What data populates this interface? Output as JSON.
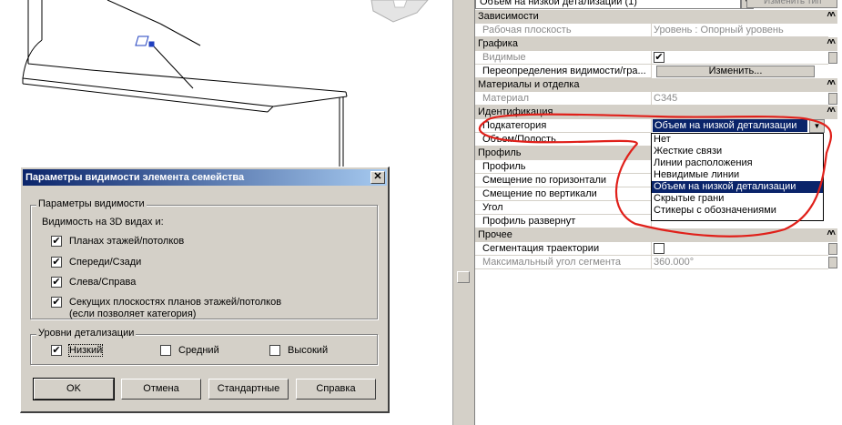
{
  "palette": {
    "type_selector": "Объем на низкой детализации (1)",
    "edit_type_label": "Изменить тип",
    "groups": {
      "constraints": "Зависимости",
      "graphics": "Графика",
      "materials": "Материалы и отделка",
      "identity": "Идентификация",
      "profile": "Профиль",
      "other": "Прочее"
    },
    "props": {
      "work_plane": {
        "name": "Рабочая плоскость",
        "value": "Уровень : Опорный уровень"
      },
      "visible": {
        "name": "Видимые",
        "value": "✔"
      },
      "vis_override": {
        "name": "Переопределения видимости/гра...",
        "button": "Изменить..."
      },
      "material": {
        "name": "Материал",
        "value": "C345"
      },
      "subcategory": {
        "name": "Подкатегория",
        "value": "Объем на низкой детализации"
      },
      "solid_void": {
        "name": "Объем/Полость"
      },
      "profile": {
        "name": "Профиль"
      },
      "h_offset": {
        "name": "Смещение по горизонтали"
      },
      "v_offset": {
        "name": "Смещение по вертикали"
      },
      "angle": {
        "name": "Угол"
      },
      "profile_flipped": {
        "name": "Профиль развернут"
      },
      "trajectory_seg": {
        "name": "Сегментация траектории"
      },
      "max_seg_angle": {
        "name": "Максимальный угол сегмента",
        "value": "360.000°"
      }
    },
    "subcategory_options": [
      "Нет",
      "Жесткие связи",
      "Линии расположения",
      "Невидимые линии",
      "Объем на низкой детализации",
      "Скрытые грани",
      "Стикеры с обозначениями"
    ],
    "selected_option_index": 4
  },
  "dialog": {
    "title": "Параметры видимости элемента семейства",
    "vis_group_title": "Параметры видимости",
    "vis_3d_label": "Видимость на 3D видах и:",
    "checks": {
      "plans": "Планах этажей/потолков",
      "front_back": "Спереди/Сзади",
      "left_right": "Слева/Справа",
      "cut_planes_line1": "Секущих плоскостях планов этажей/потолков",
      "cut_planes_line2": "(если позволяет категория)"
    },
    "detail_group_title": "Уровни детализации",
    "detail": {
      "coarse": "Низкий",
      "medium": "Средний",
      "fine": "Высокий"
    },
    "buttons": {
      "ok": "OK",
      "cancel": "Отмена",
      "defaults": "Стандартные",
      "help": "Справка"
    }
  },
  "colors": {
    "selection": "#0a246a",
    "annotation": "#e0201a",
    "panel": "#d4d0c8"
  }
}
